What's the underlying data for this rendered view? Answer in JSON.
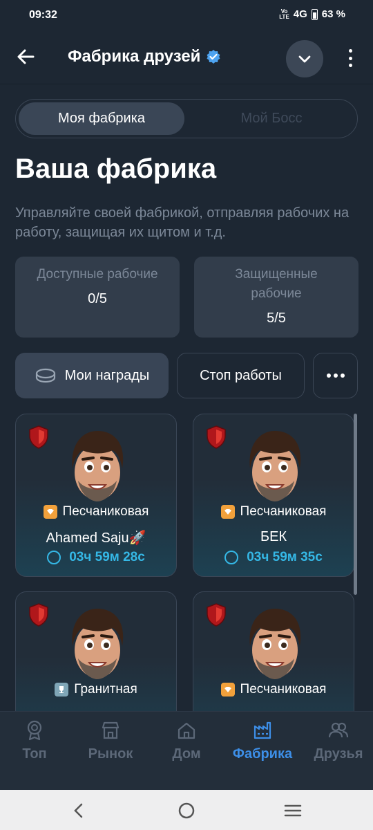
{
  "status_bar": {
    "time": "09:32",
    "network": "4G",
    "battery": "63 %"
  },
  "header": {
    "title": "Фабрика друзей"
  },
  "tabs": {
    "active": "Моя фабрика",
    "inactive": "Мой Босс"
  },
  "page": {
    "title": "Ваша фабрика",
    "description": "Управляйте своей фабрикой, отправляя рабочих на работу, защищая их щитом и т.д."
  },
  "stats": [
    {
      "label": "Доступные рабочие",
      "value": "0/5"
    },
    {
      "label": "Защищенные рабочие",
      "value": "5/5"
    }
  ],
  "actions": {
    "rewards": "Мои награды",
    "stop": "Стоп работы"
  },
  "workers": [
    {
      "rank": "Песчаниковая",
      "rank_type": "sand",
      "name": "Ahamed Saju🚀",
      "timer": "03ч 59м 28с"
    },
    {
      "rank": "Песчаниковая",
      "rank_type": "sand",
      "name": "БЕК",
      "timer": "03ч 59м 35с"
    },
    {
      "rank": "Гранитная",
      "rank_type": "granite",
      "name": "",
      "timer": ""
    },
    {
      "rank": "Песчаниковая",
      "rank_type": "sand",
      "name": "",
      "timer": ""
    }
  ],
  "nav": [
    {
      "label": "Топ",
      "icon": "medal-icon",
      "active": false
    },
    {
      "label": "Рынок",
      "icon": "store-icon",
      "active": false
    },
    {
      "label": "Дом",
      "icon": "home-icon",
      "active": false
    },
    {
      "label": "Фабрика",
      "icon": "factory-icon",
      "active": true
    },
    {
      "label": "Друзья",
      "icon": "friends-icon",
      "active": false
    }
  ],
  "colors": {
    "accent": "#3d8fe8",
    "timer": "#35b8e6",
    "background": "#1d2733"
  }
}
